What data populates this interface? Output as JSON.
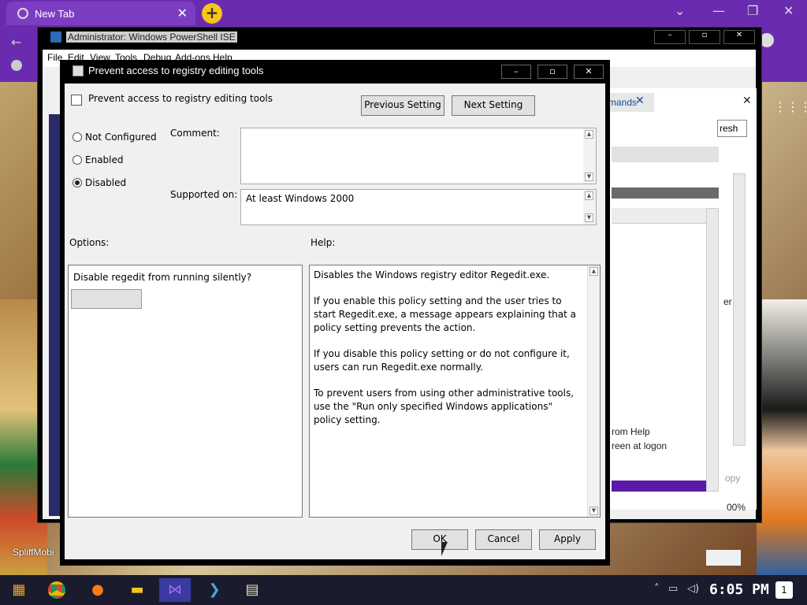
{
  "browser": {
    "tab_title": "New Tab",
    "close_glyph": "✕",
    "new_tab_glyph": "+",
    "minimize_glyph": "⌄",
    "maximize_glyph": "—",
    "restore_glyph": "❐",
    "window_close_glyph": "✕",
    "accent_color": "#6b2bb0"
  },
  "ps_window": {
    "title": "Administrator: Windows PowerShell ISE",
    "menu": [
      "File",
      "Edit",
      "View",
      "Tools",
      "Debug",
      "Add-ons",
      "Help"
    ]
  },
  "background_panel": {
    "commands_tab": "mands",
    "refresh_label": "resh",
    "text_lines": [
      "rom Help",
      "reen at logon"
    ],
    "copy_label": "opy",
    "zoom_label": "00%",
    "side_letter": "er"
  },
  "dialog": {
    "title": "Prevent access to registry editing tools",
    "header": "Prevent access to registry editing tools",
    "prev_setting": "Previous Setting",
    "next_setting": "Next Setting",
    "radios": [
      {
        "label": "Not Configured",
        "checked": false
      },
      {
        "label": "Enabled",
        "checked": false
      },
      {
        "label": "Disabled",
        "checked": true
      }
    ],
    "comment_label": "Comment:",
    "comment_value": "",
    "supported_label": "Supported on:",
    "supported_value": "At least Windows 2000",
    "options_label": "Options:",
    "help_label": "Help:",
    "options_question": "Disable regedit from running silently?",
    "help_paragraphs": [
      "Disables the Windows registry editor Regedit.exe.",
      "If you enable this policy setting and the user tries to start Regedit.exe, a message appears explaining that a policy setting prevents the action.",
      "If you disable this policy setting or do not configure it, users can run Regedit.exe normally.",
      "To prevent users from using other administrative tools, use the \"Run only specified Windows applications\" policy setting."
    ],
    "ok": "OK",
    "cancel": "Cancel",
    "apply": "Apply"
  },
  "wallpaper": {
    "caption": "SpliffMobi"
  },
  "taskbar": {
    "clock": "6:05 PM",
    "notification_count": "1",
    "apps": [
      "start-icon",
      "chrome-icon",
      "firefox-icon",
      "explorer-icon",
      "visual-studio-icon",
      "powershell-icon",
      "notepad-icon"
    ]
  }
}
